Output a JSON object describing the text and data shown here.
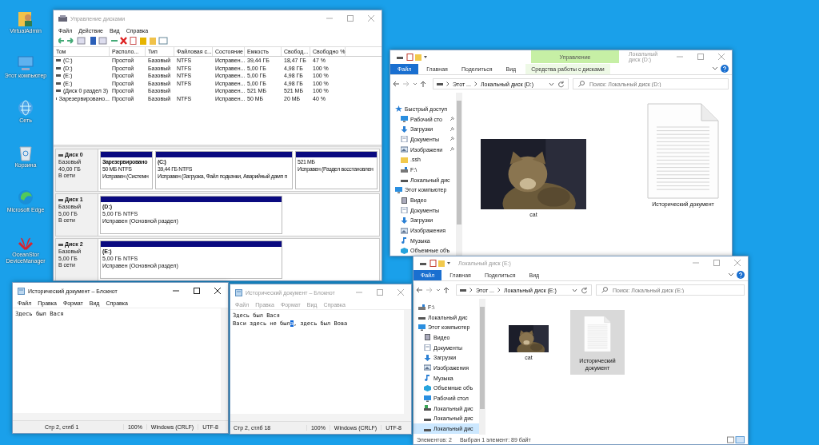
{
  "desktop_icons": [
    {
      "label": "VirtualAdmin",
      "kind": "user-folder"
    },
    {
      "label": "Этот компьютер",
      "kind": "pc"
    },
    {
      "label": "Сеть",
      "kind": "network"
    },
    {
      "label": "Корзина",
      "kind": "bin"
    },
    {
      "label": "Microsoft Edge",
      "kind": "edge"
    },
    {
      "label": "OceanStor DeviceManager",
      "kind": "flower"
    }
  ],
  "disk_management": {
    "title": "Управление дисками",
    "active": false,
    "menu": [
      "Файл",
      "Действие",
      "Вид",
      "Справка"
    ],
    "columns": [
      "Том",
      "Располо...",
      "Тип",
      "Файловая с...",
      "Состояние",
      "Емкость",
      "Свобод...",
      "Свободно %"
    ],
    "rows": [
      [
        "(C:)",
        "Простой",
        "Базовый",
        "NTFS",
        "Исправен...",
        "39,44 ГБ",
        "18,47 ГБ",
        "47 %"
      ],
      [
        "(D:)",
        "Простой",
        "Базовый",
        "NTFS",
        "Исправен...",
        "5,00 ГБ",
        "4,98 ГБ",
        "100 %"
      ],
      [
        "(E:)",
        "Простой",
        "Базовый",
        "NTFS",
        "Исправен...",
        "5,00 ГБ",
        "4,98 ГБ",
        "100 %"
      ],
      [
        "(E:)",
        "Простой",
        "Базовый",
        "NTFS",
        "Исправен...",
        "5,00 ГБ",
        "4,98 ГБ",
        "100 %"
      ],
      [
        "(Диск 0 раздел 3)",
        "Простой",
        "Базовый",
        null,
        "Исправен...",
        "521 МБ",
        "521 МБ",
        "100 %"
      ],
      [
        "Зарезервировано...",
        "Простой",
        "Базовый",
        "NTFS",
        "Исправен...",
        "50 МБ",
        "20 МБ",
        "40 %"
      ]
    ],
    "disks": [
      {
        "name": "Диск 0",
        "type": "Базовый",
        "size": "40,00 ГБ",
        "status": "В сети",
        "partitions": [
          {
            "name": "Зарезервировано",
            "detail": "50 МБ NTFS",
            "health": "Исправен (Системн"
          },
          {
            "name": "(C:)",
            "detail": "39,44 ГБ NTFS",
            "health": "Исправен (Загрузка, Файл подкачки, Аварийный дамп п"
          },
          {
            "detail": "521 МБ",
            "health": "Исправен (Раздел восстановлен"
          }
        ]
      },
      {
        "name": "Диск 1",
        "type": "Базовый",
        "size": "5,00 ГБ",
        "status": "В сети",
        "partitions": [
          {
            "name": "(D:)",
            "detail": "5,00 ГБ NTFS",
            "health": "Исправен (Основной раздел)"
          }
        ]
      },
      {
        "name": "Диск 2",
        "type": "Базовый",
        "size": "5,00 ГБ",
        "status": "В сети",
        "partitions": [
          {
            "name": "(E:)",
            "detail": "5,00 ГБ NTFS",
            "health": "Исправен (Основной раздел)"
          }
        ]
      }
    ]
  },
  "explorer_d": {
    "title": "Локальный диск (D:)",
    "active": false,
    "context_tab": {
      "group": "Управление",
      "label": "Средства работы с дисками"
    },
    "tabs": [
      {
        "label": "Файл",
        "kind": "file"
      },
      {
        "label": "Главная",
        "kind": "tab"
      },
      {
        "label": "Поделиться",
        "kind": "tab"
      },
      {
        "label": "Вид",
        "kind": "tab"
      }
    ],
    "path": [
      "Этот ...",
      "Локальный диск (D:)"
    ],
    "search": {
      "placeholder": "Поиск: Локальный диск (D:)"
    },
    "nav": [
      {
        "label": "Быстрый доступ",
        "kind": "star",
        "selected": false,
        "children": [
          {
            "label": "Рабочий сто",
            "kind": "desktop",
            "pinned": true,
            "selected": false
          },
          {
            "label": "Загрузки",
            "kind": "download",
            "pinned": true,
            "selected": false
          },
          {
            "label": "Документы",
            "kind": "document",
            "pinned": true,
            "selected": false
          },
          {
            "label": "Изображени",
            "kind": "pictures",
            "pinned": true,
            "selected": false
          },
          {
            "label": ".ssh",
            "kind": "folder",
            "pinned": false,
            "selected": false
          },
          {
            "label": "F:\\",
            "kind": "usb",
            "pinned": false,
            "selected": false
          },
          {
            "label": "Локальный дис",
            "kind": "drive",
            "pinned": false,
            "selected": false
          }
        ]
      },
      {
        "label": "Этот компьютер",
        "kind": "pc",
        "selected": false,
        "children": [
          {
            "label": "Видео",
            "kind": "video",
            "selected": false
          },
          {
            "label": "Документы",
            "kind": "document",
            "selected": false
          },
          {
            "label": "Загрузки",
            "kind": "download",
            "selected": false
          },
          {
            "label": "Изображения",
            "kind": "pictures",
            "selected": false
          },
          {
            "label": "Музыка",
            "kind": "music",
            "selected": false
          },
          {
            "label": "Объемные объ",
            "kind": "objects",
            "selected": false
          }
        ]
      }
    ],
    "files": [
      {
        "name": "cat",
        "kind": "picture",
        "selected": false
      },
      {
        "name": "Исторический документ",
        "kind": "document",
        "selected": false
      }
    ]
  },
  "explorer_e": {
    "title": "Локальный диск (E:)",
    "active": false,
    "tabs": [
      {
        "label": "Файл",
        "kind": "file"
      },
      {
        "label": "Главная",
        "kind": "tab"
      },
      {
        "label": "Поделиться",
        "kind": "tab"
      },
      {
        "label": "Вид",
        "kind": "tab"
      }
    ],
    "path": [
      "Этот ...",
      "Локальный диск (E:)"
    ],
    "search": {
      "placeholder": "Поиск: Локальный диск (E:)"
    },
    "nav": [
      {
        "label": "F:\\",
        "kind": "usb",
        "selected": false
      },
      {
        "label": "Локальный дис",
        "kind": "drive",
        "selected": false
      },
      {
        "label": "Этот компьютер",
        "kind": "pc",
        "selected": false,
        "children": [
          {
            "label": "Видео",
            "kind": "video",
            "selected": false
          },
          {
            "label": "Документы",
            "kind": "document",
            "selected": false
          },
          {
            "label": "Загрузки",
            "kind": "download",
            "selected": false
          },
          {
            "label": "Изображения",
            "kind": "pictures",
            "selected": false
          },
          {
            "label": "Музыка",
            "kind": "music",
            "selected": false
          },
          {
            "label": "Объемные объ",
            "kind": "objects",
            "selected": false
          },
          {
            "label": "Рабочий стол",
            "kind": "desktop",
            "selected": false
          },
          {
            "label": "Локальный дис",
            "kind": "netdrive",
            "selected": false
          },
          {
            "label": "Локальный дис",
            "kind": "drive",
            "selected": false
          },
          {
            "label": "Локальный дис",
            "kind": "drive",
            "selected": true
          }
        ]
      }
    ],
    "files": [
      {
        "name": "cat",
        "kind": "picture",
        "selected": false
      },
      {
        "name": "Исторический документ",
        "kind": "document",
        "selected": true
      }
    ],
    "status": [
      "Элементов: 2",
      "Выбран 1 элемент: 89 байт"
    ]
  },
  "notepads": [
    {
      "title": "Исторический документ – Блокнот",
      "active": true,
      "menu": [
        "Файл",
        "Правка",
        "Формат",
        "Вид",
        "Справка"
      ],
      "lines": [
        [
          {
            "text": "Здесь был Вася",
            "selected": false
          }
        ]
      ],
      "status": [
        "Стр 2, стлб 1",
        "100%",
        "Windows (CRLF)",
        "UTF-8"
      ]
    },
    {
      "title": "Исторический документ – Блокнот",
      "active": false,
      "menu": [
        "Файл",
        "Правка",
        "Формат",
        "Вид",
        "Справка"
      ],
      "lines": [
        [
          {
            "text": "Здесь был Вася",
            "selected": false
          }
        ],
        [
          {
            "text": "Васи здесь не был",
            "selected": false
          },
          {
            "text": "а",
            "selected": true
          },
          {
            "text": ", здесь был Вова",
            "selected": false
          }
        ]
      ],
      "status": [
        "Стр 2, стлб 18",
        "100%",
        "Windows (CRLF)",
        "UTF-8"
      ]
    }
  ]
}
